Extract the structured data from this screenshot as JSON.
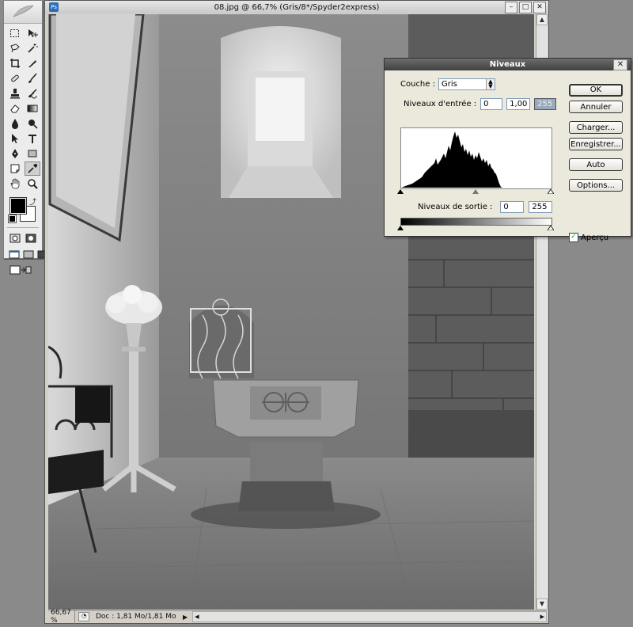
{
  "document": {
    "title": "08.jpg @ 66,7% (Gris/8*/Spyder2express)",
    "zoom": "66,67 %",
    "doc_info": "Doc : 1,81 Mo/1,81 Mo"
  },
  "toolbox": {
    "tools": [
      "marquee-tool",
      "move-tool",
      "lasso-tool",
      "magic-wand-tool",
      "crop-tool",
      "slice-tool",
      "healing-brush-tool",
      "brush-tool",
      "clone-stamp-tool",
      "history-brush-tool",
      "eraser-tool",
      "gradient-tool",
      "blur-tool",
      "dodge-tool",
      "path-selection-tool",
      "type-tool",
      "pen-tool",
      "shape-tool",
      "notes-tool",
      "eyedropper-tool",
      "hand-tool",
      "zoom-tool"
    ],
    "foreground_color": "#000000",
    "background_color": "#ffffff"
  },
  "levels_dialog": {
    "title": "Niveaux",
    "channel_label": "Couche :",
    "channel_value": "Gris",
    "input_label": "Niveaux d'entrée :",
    "input_black": "0",
    "input_gamma": "1,00",
    "input_white": "255",
    "output_label": "Niveaux de sortie :",
    "output_black": "0",
    "output_white": "255",
    "buttons": {
      "ok": "OK",
      "cancel": "Annuler",
      "load": "Charger...",
      "save": "Enregistrer...",
      "auto": "Auto",
      "options": "Options..."
    },
    "preview_label": "Aperçu",
    "preview_checked": true,
    "input_slider_positions": [
      0,
      0.5,
      1.0
    ]
  }
}
